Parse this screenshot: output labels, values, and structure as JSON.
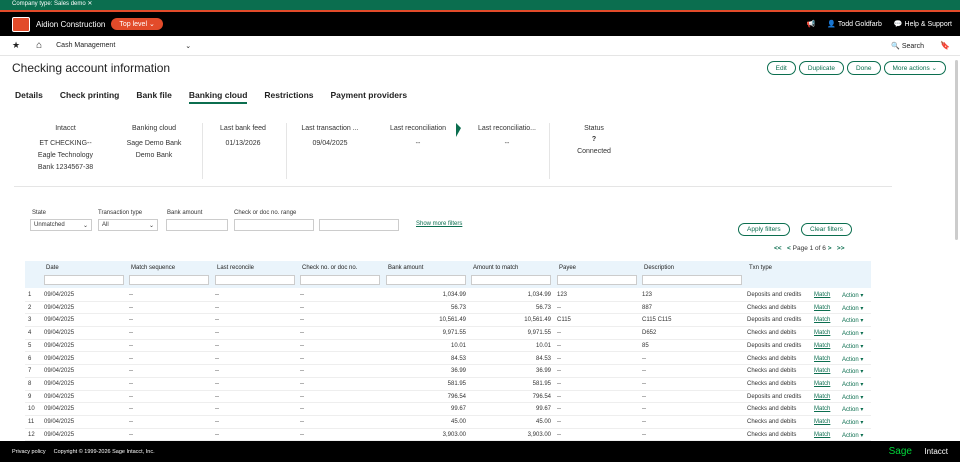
{
  "banner": {
    "company_type": "Company type: Sales demo"
  },
  "topbar": {
    "company": "Aidion Construction",
    "level": "Top level",
    "user": "Todd Goldfarb",
    "help": "Help & Support"
  },
  "nav": {
    "module": "Cash Management",
    "search": "Search"
  },
  "page": {
    "title": "Checking account information"
  },
  "actions": {
    "edit": "Edit",
    "duplicate": "Duplicate",
    "done": "Done",
    "more": "More actions"
  },
  "tabs": [
    "Details",
    "Check printing",
    "Bank file",
    "Banking cloud",
    "Restrictions",
    "Payment providers"
  ],
  "summary": {
    "intacct_h": "Intacct",
    "intacct_v1": "ET CHECKING--",
    "intacct_v2": "Eagle Technology",
    "intacct_v3": "Bank 1234567-38",
    "cloud_h": "Banking cloud",
    "cloud_v1": "Sage Demo Bank",
    "cloud_v2": "Demo Bank",
    "feed_h": "Last bank feed",
    "feed_v": "01/13/2026",
    "trans_h": "Last transaction ...",
    "trans_v": "09/04/2025",
    "rec1_h": "Last reconciliation",
    "rec1_v": "--",
    "rec2_h": "Last reconciliatio...",
    "rec2_v": "--",
    "status_h": "Status",
    "status_v": "Connected"
  },
  "filters": {
    "state_l": "State",
    "state_v": "Unmatched",
    "ttype_l": "Transaction type",
    "ttype_v": "All",
    "amount_l": "Bank amount",
    "check_l": "Check or doc no. range",
    "showmore": "Show more filters",
    "apply": "Apply filters",
    "clear": "Clear filters"
  },
  "pager": {
    "first": "<<",
    "prev": "<",
    "label": "Page 1 of 6",
    "next": ">",
    "last": ">>"
  },
  "columns": [
    "Date",
    "Match sequence",
    "Last reconcile",
    "Check no. or doc no.",
    "Bank amount",
    "Amount to match",
    "Payee",
    "Description",
    "Txn type"
  ],
  "rows": [
    {
      "n": "1",
      "date": "09/04/2025",
      "seq": "--",
      "rec": "--",
      "chk": "--",
      "bank": "1,034.99",
      "amt": "1,034.99",
      "payee": "123",
      "desc": "123",
      "type": "Deposits and credits"
    },
    {
      "n": "2",
      "date": "09/04/2025",
      "seq": "--",
      "rec": "--",
      "chk": "--",
      "bank": "56.73",
      "amt": "56.73",
      "payee": "--",
      "desc": "887",
      "type": "Checks and debits"
    },
    {
      "n": "3",
      "date": "09/04/2025",
      "seq": "--",
      "rec": "--",
      "chk": "--",
      "bank": "10,561.49",
      "amt": "10,561.49",
      "payee": "C115",
      "desc": "C115 C115",
      "type": "Deposits and credits"
    },
    {
      "n": "4",
      "date": "09/04/2025",
      "seq": "--",
      "rec": "--",
      "chk": "--",
      "bank": "9,971.55",
      "amt": "9,971.55",
      "payee": "--",
      "desc": "D652",
      "type": "Checks and debits"
    },
    {
      "n": "5",
      "date": "09/04/2025",
      "seq": "--",
      "rec": "--",
      "chk": "--",
      "bank": "10.01",
      "amt": "10.01",
      "payee": "--",
      "desc": "85",
      "type": "Deposits and credits"
    },
    {
      "n": "6",
      "date": "09/04/2025",
      "seq": "--",
      "rec": "--",
      "chk": "--",
      "bank": "84.53",
      "amt": "84.53",
      "payee": "--",
      "desc": "--",
      "type": "Checks and debits"
    },
    {
      "n": "7",
      "date": "09/04/2025",
      "seq": "--",
      "rec": "--",
      "chk": "--",
      "bank": "36.99",
      "amt": "36.99",
      "payee": "--",
      "desc": "--",
      "type": "Checks and debits"
    },
    {
      "n": "8",
      "date": "09/04/2025",
      "seq": "--",
      "rec": "--",
      "chk": "--",
      "bank": "581.95",
      "amt": "581.95",
      "payee": "--",
      "desc": "--",
      "type": "Checks and debits"
    },
    {
      "n": "9",
      "date": "09/04/2025",
      "seq": "--",
      "rec": "--",
      "chk": "--",
      "bank": "796.54",
      "amt": "796.54",
      "payee": "--",
      "desc": "--",
      "type": "Deposits and credits"
    },
    {
      "n": "10",
      "date": "09/04/2025",
      "seq": "--",
      "rec": "--",
      "chk": "--",
      "bank": "99.67",
      "amt": "99.67",
      "payee": "--",
      "desc": "--",
      "type": "Checks and debits"
    },
    {
      "n": "11",
      "date": "09/04/2025",
      "seq": "--",
      "rec": "--",
      "chk": "--",
      "bank": "45.00",
      "amt": "45.00",
      "payee": "--",
      "desc": "--",
      "type": "Checks and debits"
    },
    {
      "n": "12",
      "date": "09/04/2025",
      "seq": "--",
      "rec": "--",
      "chk": "--",
      "bank": "3,903.00",
      "amt": "3,903.00",
      "payee": "--",
      "desc": "--",
      "type": "Checks and debits"
    }
  ],
  "row_links": {
    "match": "Match",
    "action": "Action"
  },
  "footer": {
    "privacy": "Privacy policy",
    "copyright": "Copyright © 1999-2026 Sage Intacct, Inc.",
    "sage": "Sage",
    "intacct": "Intacct"
  },
  "colors": {
    "brand_green": "#0b6e4f",
    "accent_red": "#e24b2a",
    "sage_green": "#00d639"
  }
}
